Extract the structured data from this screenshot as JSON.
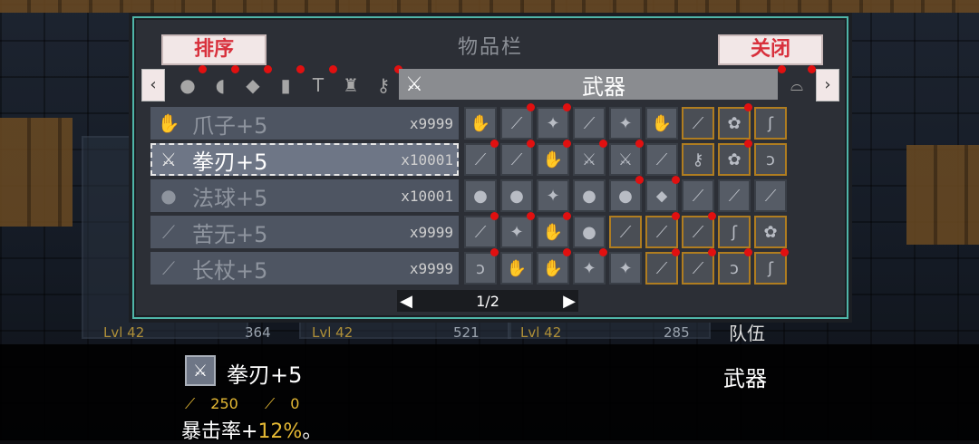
{
  "window": {
    "title": "物品栏",
    "sort_label": "排序",
    "close_label": "关闭",
    "active_tab_label": "武器",
    "prev_arrow": "‹",
    "next_arrow": "›",
    "tabs": [
      {
        "icon": "potion-icon",
        "glyph": "●",
        "badge": true
      },
      {
        "icon": "scroll-icon",
        "glyph": "◖",
        "badge": true
      },
      {
        "icon": "food-icon",
        "glyph": "◆",
        "badge": true
      },
      {
        "icon": "flask-icon",
        "glyph": "▮",
        "badge": true
      },
      {
        "icon": "hammer-icon",
        "glyph": "T",
        "badge": true
      },
      {
        "icon": "altar-icon",
        "glyph": "♜",
        "badge": false
      },
      {
        "icon": "key-icon",
        "glyph": "⚷",
        "badge": true
      }
    ],
    "active_tab_icon": "sword-icon",
    "active_tab_glyph": "⚔",
    "extra_tab_icon": "helmet-icon",
    "extra_tab_glyph": "⌓"
  },
  "weapon_list": [
    {
      "name": "爪子+5",
      "count": "x9999",
      "icon": "claw-icon",
      "glyph": "✋",
      "selected": false
    },
    {
      "name": "拳刃+5",
      "count": "x10001",
      "icon": "fist-blade-icon",
      "glyph": "⚔",
      "selected": true
    },
    {
      "name": "法球+5",
      "count": "x10001",
      "icon": "orb-icon",
      "glyph": "●",
      "selected": false
    },
    {
      "name": "苦无+5",
      "count": "x9999",
      "icon": "kunai-icon",
      "glyph": "⟋",
      "selected": false
    },
    {
      "name": "长杖+5",
      "count": "x9999",
      "icon": "staff-icon",
      "glyph": "⟋",
      "selected": false
    }
  ],
  "grid_items": [
    {
      "glyph": "✋",
      "gold": false,
      "badge": false
    },
    {
      "glyph": "⟋",
      "gold": false,
      "badge": true
    },
    {
      "glyph": "✦",
      "gold": false,
      "badge": true
    },
    {
      "glyph": "⟋",
      "gold": false,
      "badge": false
    },
    {
      "glyph": "✦",
      "gold": false,
      "badge": false
    },
    {
      "glyph": "✋",
      "gold": false,
      "badge": false
    },
    {
      "glyph": "⟋",
      "gold": true,
      "badge": false
    },
    {
      "glyph": "✿",
      "gold": true,
      "badge": true
    },
    {
      "glyph": "ʃ",
      "gold": true,
      "badge": false
    },
    {
      "glyph": "⟋",
      "gold": false,
      "badge": true
    },
    {
      "glyph": "⟋",
      "gold": false,
      "badge": true
    },
    {
      "glyph": "✋",
      "gold": false,
      "badge": true
    },
    {
      "glyph": "⚔",
      "gold": false,
      "badge": true
    },
    {
      "glyph": "⚔",
      "gold": false,
      "badge": true
    },
    {
      "glyph": "⟋",
      "gold": false,
      "badge": false
    },
    {
      "glyph": "⚷",
      "gold": true,
      "badge": false
    },
    {
      "glyph": "✿",
      "gold": true,
      "badge": true
    },
    {
      "glyph": "ↄ",
      "gold": true,
      "badge": false
    },
    {
      "glyph": "●",
      "gold": false,
      "badge": false
    },
    {
      "glyph": "●",
      "gold": false,
      "badge": false
    },
    {
      "glyph": "✦",
      "gold": false,
      "badge": false
    },
    {
      "glyph": "●",
      "gold": false,
      "badge": false
    },
    {
      "glyph": "●",
      "gold": false,
      "badge": true
    },
    {
      "glyph": "⬥",
      "gold": false,
      "badge": true
    },
    {
      "glyph": "⟋",
      "gold": false,
      "badge": false
    },
    {
      "glyph": "⟋",
      "gold": false,
      "badge": false
    },
    {
      "glyph": "⟋",
      "gold": false,
      "badge": false
    },
    {
      "glyph": "⟋",
      "gold": false,
      "badge": true
    },
    {
      "glyph": "✦",
      "gold": false,
      "badge": true
    },
    {
      "glyph": "✋",
      "gold": false,
      "badge": true
    },
    {
      "glyph": "●",
      "gold": false,
      "badge": false
    },
    {
      "glyph": "⟋",
      "gold": true,
      "badge": false
    },
    {
      "glyph": "⟋",
      "gold": true,
      "badge": true
    },
    {
      "glyph": "⟋",
      "gold": true,
      "badge": true
    },
    {
      "glyph": "ʃ",
      "gold": true,
      "badge": false
    },
    {
      "glyph": "✿",
      "gold": true,
      "badge": false
    },
    {
      "glyph": "ↄ",
      "gold": false,
      "badge": true
    },
    {
      "glyph": "✋",
      "gold": false,
      "badge": false
    },
    {
      "glyph": "✋",
      "gold": false,
      "badge": true
    },
    {
      "glyph": "✦",
      "gold": false,
      "badge": true
    },
    {
      "glyph": "✦",
      "gold": false,
      "badge": false
    },
    {
      "glyph": "⟋",
      "gold": true,
      "badge": true
    },
    {
      "glyph": "⟋",
      "gold": true,
      "badge": true
    },
    {
      "glyph": "ↄ",
      "gold": true,
      "badge": true
    },
    {
      "glyph": "ʃ",
      "gold": true,
      "badge": true
    }
  ],
  "pager": {
    "text": "1/2",
    "left": "◀",
    "right": "▶"
  },
  "detail": {
    "name": "拳刃+5",
    "type": "武器",
    "icon": "fist-blade-icon",
    "glyph": "⚔",
    "attack": "250",
    "magic": "0",
    "attack_icon": "sword-stat-icon",
    "magic_icon": "wand-stat-icon",
    "desc_prefix": "暴击率+",
    "desc_value": "12%",
    "desc_suffix": "。"
  },
  "background": {
    "levels": [
      "Lvl 42",
      "Lvl 42",
      "Lvl 42"
    ],
    "numbers": [
      "364",
      "521",
      "285"
    ],
    "team_label": "队伍"
  }
}
